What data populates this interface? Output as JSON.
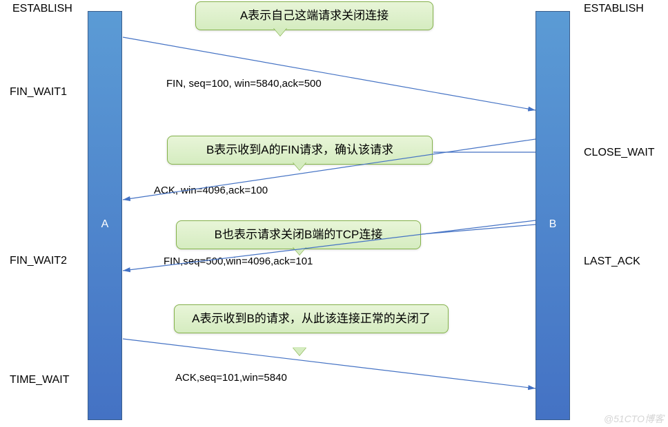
{
  "states_left": {
    "establish": "ESTABLISH",
    "fin_wait1": "FIN_WAIT1",
    "fin_wait2": "FIN_WAIT2",
    "time_wait": "TIME_WAIT"
  },
  "states_right": {
    "establish": "ESTABLISH",
    "close_wait": "CLOSE_WAIT",
    "last_ack": "LAST_ACK"
  },
  "bars": {
    "a": "A",
    "b": "B"
  },
  "callouts": {
    "c1": "A表示自己这端请求关闭连接",
    "c2": "B表示收到A的FIN请求，确认该请求",
    "c3": "B也表示请求关闭B端的TCP连接",
    "c4": "A表示收到B的请求，从此该连接正常的关闭了"
  },
  "packets": {
    "p1": "FIN, seq=100, win=5840,ack=500",
    "p2": "ACK, win=4096,ack=100",
    "p3": "FIN,seq=500,win=4096,ack=101",
    "p4": "ACK,seq=101,win=5840"
  },
  "watermark": "@51CTO博客"
}
